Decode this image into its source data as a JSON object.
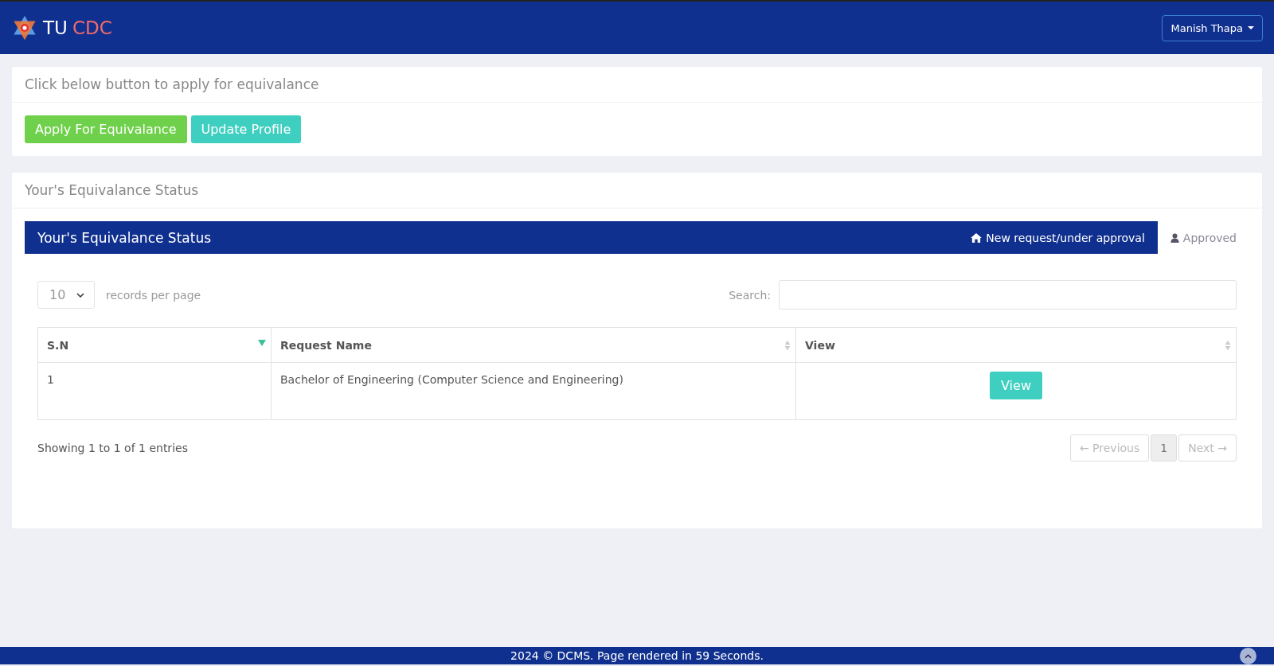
{
  "header": {
    "brand_first": "TU",
    "brand_second": "CDC",
    "user_menu": "Manish Thapa"
  },
  "apply_card": {
    "title": "Click below button to apply for equivalance",
    "buttons": [
      {
        "label": "Apply For Equivalance",
        "kind": "success"
      },
      {
        "label": "Update Profile",
        "kind": "info"
      }
    ]
  },
  "status_card": {
    "title": "Your's Equivalance Status",
    "panel_title": "Your's Equivalance Status",
    "tabs": [
      {
        "label": "New request/under approval",
        "selected": true
      },
      {
        "label": "Approved",
        "selected": false
      }
    ],
    "page_size": "10",
    "page_size_label": "records per page",
    "search_label": "Search:",
    "table": {
      "columns": [
        {
          "label": "S.N",
          "sorted": true
        },
        {
          "label": "Request Name",
          "sorted": false
        },
        {
          "label": "View",
          "sorted": false
        }
      ],
      "rows": [
        {
          "sn": "1",
          "request_name": "Bachelor of Engineering (Computer Science and Engineering)",
          "action": "View"
        }
      ]
    },
    "info": "Showing 1 to 1 of 1 entries",
    "pagination": [
      {
        "label": "← Previous",
        "selected": false,
        "disabled": true
      },
      {
        "label": "1",
        "selected": true,
        "disabled": false
      },
      {
        "label": "Next →",
        "selected": false,
        "disabled": true
      }
    ]
  },
  "footer": {
    "text": "2024 © DCMS. Page rendered in 59 Seconds."
  }
}
